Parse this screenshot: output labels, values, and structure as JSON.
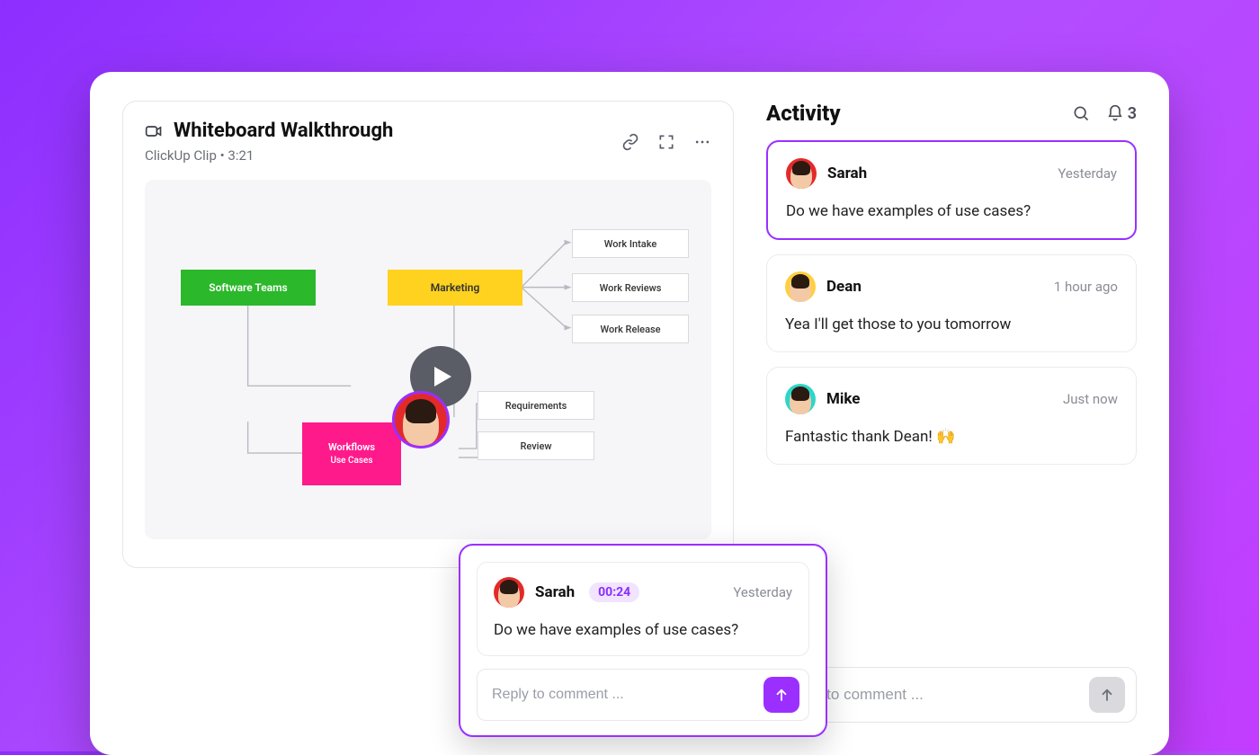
{
  "clip": {
    "title": "Whiteboard Walkthrough",
    "source": "ClickUp Clip",
    "duration": "3:21",
    "presenter": "Sarah"
  },
  "whiteboard": {
    "nodes": {
      "software_teams": "Software Teams",
      "marketing": "Marketing",
      "workflows": "Workflows",
      "workflows_sub": "Use Cases",
      "work_intake": "Work Intake",
      "work_reviews": "Work Reviews",
      "work_release": "Work Release",
      "requirements": "Requirements",
      "review": "Review"
    }
  },
  "popup_comment": {
    "author": "Sarah",
    "timestamp_badge": "00:24",
    "relative_time": "Yesterday",
    "body": "Do we have examples of use cases?",
    "reply_placeholder": "Reply to comment ..."
  },
  "activity": {
    "title": "Activity",
    "notification_count": "3",
    "reply_placeholder": "Reply to comment ...",
    "comments": [
      {
        "author": "Sarah",
        "time": "Yesterday",
        "body": "Do we have examples of use cases?",
        "highlight": true,
        "avatar_color": "av-red"
      },
      {
        "author": "Dean",
        "time": "1 hour ago",
        "body": "Yea I'll get those to you tomorrow",
        "highlight": false,
        "avatar_color": "av-yellow"
      },
      {
        "author": "Mike",
        "time": "Just now",
        "body": "Fantastic thank Dean! 🙌",
        "highlight": false,
        "avatar_color": "av-teal"
      }
    ]
  }
}
